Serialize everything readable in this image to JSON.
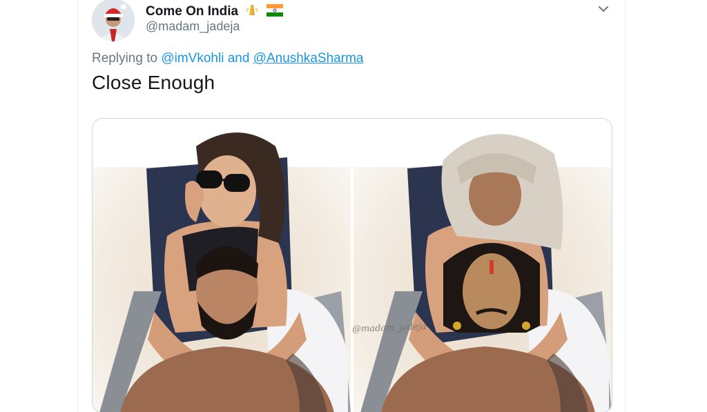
{
  "tweet": {
    "display_name": "Come On India",
    "name_emojis": [
      "folded-hands-emoji",
      "india-flag-emoji"
    ],
    "handle": "@madam_jadeja",
    "replying_prefix": "Replying to",
    "reply_to_1": "@imVkohli",
    "reply_joiner": "and",
    "reply_to_2": "@AnushkaSharma",
    "text": "Close Enough",
    "watermark": "@madam_jadeja"
  },
  "colors": {
    "link": "#1b95e0",
    "secondary_text": "#657786",
    "primary_text": "#14171a",
    "border": "#ccd6dd"
  },
  "icons": {
    "menu": "chevron-down-icon"
  }
}
